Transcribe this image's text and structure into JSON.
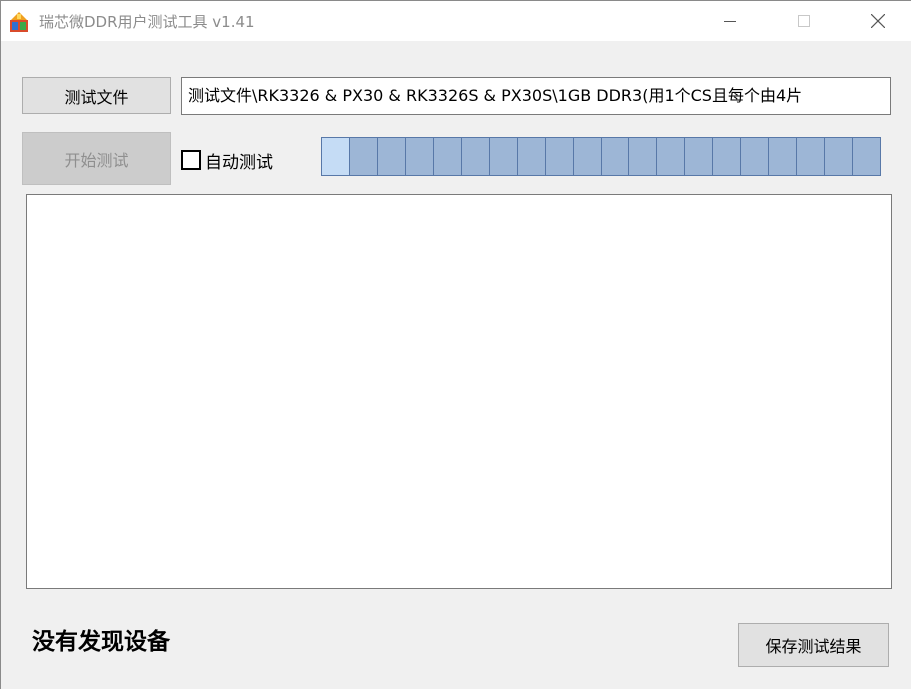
{
  "window": {
    "title": "瑞芯微DDR用户测试工具 v1.41",
    "icons": {
      "app": "app-icon",
      "minimize": "minimize-icon",
      "maximize": "maximize-icon",
      "close": "close-icon"
    }
  },
  "toolbar": {
    "test_file_label": "测试文件",
    "start_test_label": "开始测试",
    "file_path_value": "测试文件\\RK3326 & PX30 & RK3326S & PX30S\\1GB DDR3(用1个CS且每个由4片",
    "auto_test_label": "自动测试",
    "auto_test_checked": false
  },
  "progress": {
    "segment_count": 20,
    "active_segments": 1
  },
  "log": {
    "content": ""
  },
  "footer": {
    "status": "没有发现设备",
    "save_label": "保存测试结果"
  },
  "colors": {
    "progress_fill": "#9db6d6",
    "progress_active": "#c5dcf5",
    "progress_border": "#5878a8"
  }
}
